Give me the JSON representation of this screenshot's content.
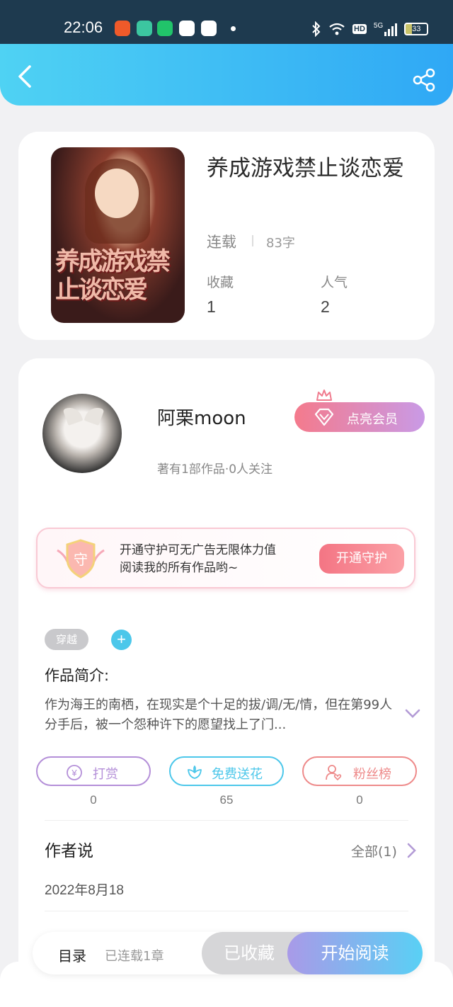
{
  "status_bar": {
    "time": "22:06",
    "signal": "5G",
    "hd": "HD",
    "battery": "33"
  },
  "header": {
    "back_icon": "chevron-left-icon",
    "share_icon": "share-icon"
  },
  "book": {
    "title": "养成游戏禁止谈恋爱",
    "status": "连载",
    "word_count": "83字",
    "cover_title": "养成游戏禁止谈恋爱",
    "stats": [
      {
        "label": "收藏",
        "value": "1"
      },
      {
        "label": "人气",
        "value": "2"
      }
    ]
  },
  "author": {
    "name": "阿栗moon",
    "meta": "著有1部作品·0人关注",
    "vip_label": "点亮会员"
  },
  "guard": {
    "badge_char": "守",
    "line1": "开通守护可无广告无限体力值",
    "line2": "阅读我的所有作品哟~",
    "button": "开通守护"
  },
  "tags": [
    {
      "label": "穿越"
    }
  ],
  "tag_add": "+",
  "intro": {
    "title": "作品简介:",
    "text": "作为海王的南栖，在现实是个十足的拔/调/无/情，但在第99人分手后，被一个怨种许下的愿望找上了门..."
  },
  "actions": [
    {
      "label": "打赏",
      "count": "0",
      "color": "#b48fd8"
    },
    {
      "label": "免费送花",
      "count": "65",
      "color": "#4cc7ea"
    },
    {
      "label": "粉丝榜",
      "count": "0",
      "color": "#ee8a8a"
    }
  ],
  "author_says": {
    "title": "作者说",
    "all_label": "全部(1)",
    "date": "2022年8月18"
  },
  "bottom_bar": {
    "toc_label": "目录",
    "toc_count": "已连载1章",
    "collected_label": "已收藏",
    "read_label": "开始阅读"
  }
}
